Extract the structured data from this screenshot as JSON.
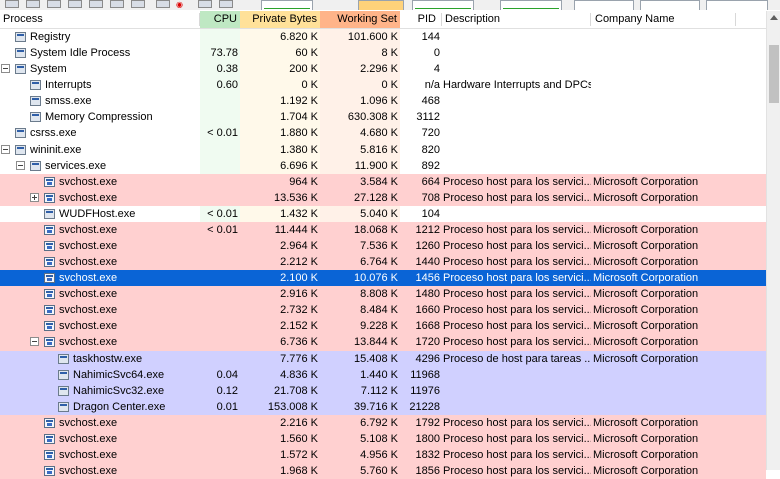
{
  "columns": {
    "process": "Process",
    "cpu": "CPU",
    "private_bytes": "Private Bytes",
    "working_set": "Working Set",
    "pid": "PID",
    "description": "Description",
    "company": "Company Name"
  },
  "colors": {
    "cpu_header": "#bfe8c3",
    "private_bytes_header": "#ffe199",
    "working_set_header": "#ffb489",
    "service_row": "#ffd0d0",
    "own_process_row": "#d0d0ff",
    "selected_row": "#0a64d6"
  },
  "rows": [
    {
      "name": "Registry",
      "cpu": "",
      "priv": "6.820 K",
      "ws": "101.600 K",
      "pid": "144",
      "desc": "",
      "comp": ""
    },
    {
      "name": "System Idle Process",
      "cpu": "73.78",
      "priv": "60 K",
      "ws": "8 K",
      "pid": "0",
      "desc": "",
      "comp": ""
    },
    {
      "name": "System",
      "cpu": "0.38",
      "priv": "200 K",
      "ws": "2.296 K",
      "pid": "4",
      "desc": "",
      "comp": ""
    },
    {
      "name": "Interrupts",
      "cpu": "0.60",
      "priv": "0 K",
      "ws": "0 K",
      "pid": "n/a",
      "desc": "Hardware Interrupts and DPCs",
      "comp": ""
    },
    {
      "name": "smss.exe",
      "cpu": "",
      "priv": "1.192 K",
      "ws": "1.096 K",
      "pid": "468",
      "desc": "",
      "comp": ""
    },
    {
      "name": "Memory Compression",
      "cpu": "",
      "priv": "1.704 K",
      "ws": "630.308 K",
      "pid": "3112",
      "desc": "",
      "comp": ""
    },
    {
      "name": "csrss.exe",
      "cpu": "< 0.01",
      "priv": "1.880 K",
      "ws": "4.680 K",
      "pid": "720",
      "desc": "",
      "comp": ""
    },
    {
      "name": "wininit.exe",
      "cpu": "",
      "priv": "1.380 K",
      "ws": "5.816 K",
      "pid": "820",
      "desc": "",
      "comp": ""
    },
    {
      "name": "services.exe",
      "cpu": "",
      "priv": "6.696 K",
      "ws": "11.900 K",
      "pid": "892",
      "desc": "",
      "comp": ""
    },
    {
      "name": "svchost.exe",
      "cpu": "",
      "priv": "964 K",
      "ws": "3.584 K",
      "pid": "664",
      "desc": "Proceso host para los servici...",
      "comp": "Microsoft Corporation"
    },
    {
      "name": "svchost.exe",
      "cpu": "",
      "priv": "13.536 K",
      "ws": "27.128 K",
      "pid": "708",
      "desc": "Proceso host para los servici...",
      "comp": "Microsoft Corporation"
    },
    {
      "name": "WUDFHost.exe",
      "cpu": "< 0.01",
      "priv": "1.432 K",
      "ws": "5.040 K",
      "pid": "104",
      "desc": "",
      "comp": ""
    },
    {
      "name": "svchost.exe",
      "cpu": "< 0.01",
      "priv": "11.444 K",
      "ws": "18.068 K",
      "pid": "1212",
      "desc": "Proceso host para los servici...",
      "comp": "Microsoft Corporation"
    },
    {
      "name": "svchost.exe",
      "cpu": "",
      "priv": "2.964 K",
      "ws": "7.536 K",
      "pid": "1260",
      "desc": "Proceso host para los servici...",
      "comp": "Microsoft Corporation"
    },
    {
      "name": "svchost.exe",
      "cpu": "",
      "priv": "2.212 K",
      "ws": "6.764 K",
      "pid": "1440",
      "desc": "Proceso host para los servici...",
      "comp": "Microsoft Corporation"
    },
    {
      "name": "svchost.exe",
      "cpu": "",
      "priv": "2.100 K",
      "ws": "10.076 K",
      "pid": "1456",
      "desc": "Proceso host para los servici...",
      "comp": "Microsoft Corporation"
    },
    {
      "name": "svchost.exe",
      "cpu": "",
      "priv": "2.916 K",
      "ws": "8.808 K",
      "pid": "1480",
      "desc": "Proceso host para los servici...",
      "comp": "Microsoft Corporation"
    },
    {
      "name": "svchost.exe",
      "cpu": "",
      "priv": "2.732 K",
      "ws": "8.484 K",
      "pid": "1660",
      "desc": "Proceso host para los servici...",
      "comp": "Microsoft Corporation"
    },
    {
      "name": "svchost.exe",
      "cpu": "",
      "priv": "2.152 K",
      "ws": "9.228 K",
      "pid": "1668",
      "desc": "Proceso host para los servici...",
      "comp": "Microsoft Corporation"
    },
    {
      "name": "svchost.exe",
      "cpu": "",
      "priv": "6.736 K",
      "ws": "13.844 K",
      "pid": "1720",
      "desc": "Proceso host para los servici...",
      "comp": "Microsoft Corporation"
    },
    {
      "name": "taskhostw.exe",
      "cpu": "",
      "priv": "7.776 K",
      "ws": "15.408 K",
      "pid": "4296",
      "desc": "Proceso de host para tareas ...",
      "comp": "Microsoft Corporation"
    },
    {
      "name": "NahimicSvc64.exe",
      "cpu": "0.04",
      "priv": "4.836 K",
      "ws": "1.440 K",
      "pid": "11968",
      "desc": "",
      "comp": ""
    },
    {
      "name": "NahimicSvc32.exe",
      "cpu": "0.12",
      "priv": "21.708 K",
      "ws": "7.112 K",
      "pid": "11976",
      "desc": "",
      "comp": ""
    },
    {
      "name": "Dragon Center.exe",
      "cpu": "0.01",
      "priv": "153.008 K",
      "ws": "39.716 K",
      "pid": "21228",
      "desc": "",
      "comp": ""
    },
    {
      "name": "svchost.exe",
      "cpu": "",
      "priv": "2.216 K",
      "ws": "6.792 K",
      "pid": "1792",
      "desc": "Proceso host para los servici...",
      "comp": "Microsoft Corporation"
    },
    {
      "name": "svchost.exe",
      "cpu": "",
      "priv": "1.560 K",
      "ws": "5.108 K",
      "pid": "1800",
      "desc": "Proceso host para los servici...",
      "comp": "Microsoft Corporation"
    },
    {
      "name": "svchost.exe",
      "cpu": "",
      "priv": "1.572 K",
      "ws": "4.956 K",
      "pid": "1832",
      "desc": "Proceso host para los servici...",
      "comp": "Microsoft Corporation"
    },
    {
      "name": "svchost.exe",
      "cpu": "",
      "priv": "1.968 K",
      "ws": "5.760 K",
      "pid": "1856",
      "desc": "Proceso host para los servici...",
      "comp": "Microsoft Corporation"
    }
  ]
}
